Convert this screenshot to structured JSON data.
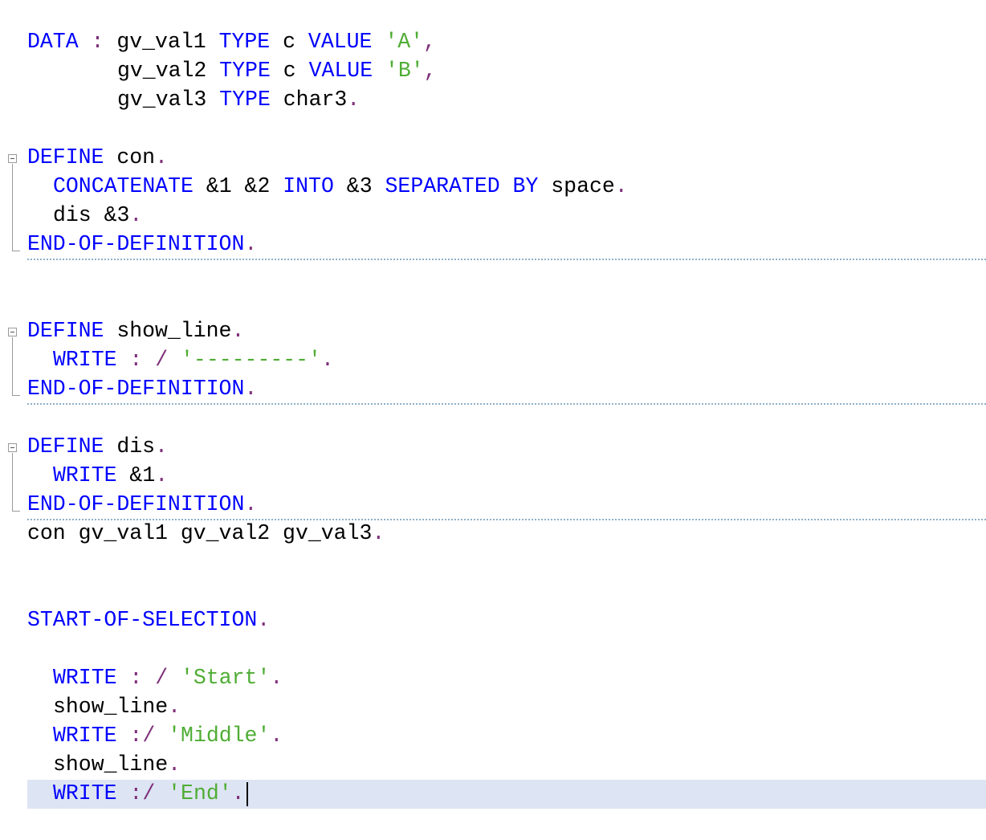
{
  "editor": {
    "lines": [
      [
        {
          "text": "DATA",
          "type": "kw"
        },
        {
          "text": " : ",
          "type": "sym"
        },
        {
          "text": "gv_val1 ",
          "type": "default"
        },
        {
          "text": "TYPE",
          "type": "kw"
        },
        {
          "text": " c ",
          "type": "default"
        },
        {
          "text": "VALUE",
          "type": "kw"
        },
        {
          "text": " ",
          "type": "default"
        },
        {
          "text": "'A'",
          "type": "str"
        },
        {
          "text": ",",
          "type": "sym"
        }
      ],
      [
        {
          "text": "gv_val2 ",
          "type": "default"
        },
        {
          "text": "TYPE",
          "type": "kw"
        },
        {
          "text": " c ",
          "type": "default"
        },
        {
          "text": "VALUE",
          "type": "kw"
        },
        {
          "text": " ",
          "type": "default"
        },
        {
          "text": "'B'",
          "type": "str"
        },
        {
          "text": ",",
          "type": "sym"
        }
      ],
      [
        {
          "text": "gv_val3 ",
          "type": "default"
        },
        {
          "text": "TYPE",
          "type": "kw"
        },
        {
          "text": " char3",
          "type": "default"
        },
        {
          "text": ".",
          "type": "sym"
        }
      ],
      [
        {
          "text": "DEFINE",
          "type": "kw"
        },
        {
          "text": " con",
          "type": "default"
        },
        {
          "text": ".",
          "type": "sym"
        }
      ],
      [
        {
          "text": "CONCATENATE",
          "type": "kw"
        },
        {
          "text": " &1 &2 ",
          "type": "default"
        },
        {
          "text": "INTO",
          "type": "kw"
        },
        {
          "text": " &3 ",
          "type": "default"
        },
        {
          "text": "SEPARATED BY",
          "type": "kw"
        },
        {
          "text": " space",
          "type": "default"
        },
        {
          "text": ".",
          "type": "sym"
        }
      ],
      [
        {
          "text": "dis &3",
          "type": "default"
        },
        {
          "text": ".",
          "type": "sym"
        }
      ],
      [
        {
          "text": "END-OF-DEFINITION",
          "type": "kw"
        },
        {
          "text": ".",
          "type": "sym"
        }
      ],
      [
        {
          "text": "DEFINE",
          "type": "kw"
        },
        {
          "text": " show_line",
          "type": "default"
        },
        {
          "text": ".",
          "type": "sym"
        }
      ],
      [
        {
          "text": "WRITE",
          "type": "kw"
        },
        {
          "text": " : / ",
          "type": "sym"
        },
        {
          "text": "'---------'",
          "type": "str"
        },
        {
          "text": ".",
          "type": "sym"
        }
      ],
      [
        {
          "text": "END-OF-DEFINITION",
          "type": "kw"
        },
        {
          "text": ".",
          "type": "sym"
        }
      ],
      [
        {
          "text": "DEFINE",
          "type": "kw"
        },
        {
          "text": " dis",
          "type": "default"
        },
        {
          "text": ".",
          "type": "sym"
        }
      ],
      [
        {
          "text": "WRITE",
          "type": "kw"
        },
        {
          "text": " &1",
          "type": "default"
        },
        {
          "text": ".",
          "type": "sym"
        }
      ],
      [
        {
          "text": "END-OF-DEFINITION",
          "type": "kw"
        },
        {
          "text": ".",
          "type": "sym"
        }
      ],
      [
        {
          "text": "con gv_val1 gv_val2 gv_val3",
          "type": "default"
        },
        {
          "text": ".",
          "type": "sym"
        }
      ],
      [
        {
          "text": "START-OF-SELECTION",
          "type": "kw"
        },
        {
          "text": ".",
          "type": "sym"
        }
      ],
      [
        {
          "text": "WRITE",
          "type": "kw"
        },
        {
          "text": " : / ",
          "type": "sym"
        },
        {
          "text": "'Start'",
          "type": "str"
        },
        {
          "text": ".",
          "type": "sym"
        }
      ],
      [
        {
          "text": "show_line",
          "type": "default"
        },
        {
          "text": ".",
          "type": "sym"
        }
      ],
      [
        {
          "text": "WRITE",
          "type": "kw"
        },
        {
          "text": " :/ ",
          "type": "sym"
        },
        {
          "text": "'Middle'",
          "type": "str"
        },
        {
          "text": ".",
          "type": "sym"
        }
      ],
      [
        {
          "text": "show_line",
          "type": "default"
        },
        {
          "text": ".",
          "type": "sym"
        }
      ],
      [
        {
          "text": "WRITE",
          "type": "kw"
        },
        {
          "text": " :/ ",
          "type": "sym"
        },
        {
          "text": "'End'",
          "type": "str"
        },
        {
          "text": ".",
          "type": "sym"
        }
      ]
    ],
    "colors": {
      "keyword": "#0000ff",
      "string": "#4fad34",
      "symbol": "#7e2f7a",
      "default": "#000000",
      "current_line": "#dde4f3",
      "separator": "#8fb0c9"
    }
  }
}
